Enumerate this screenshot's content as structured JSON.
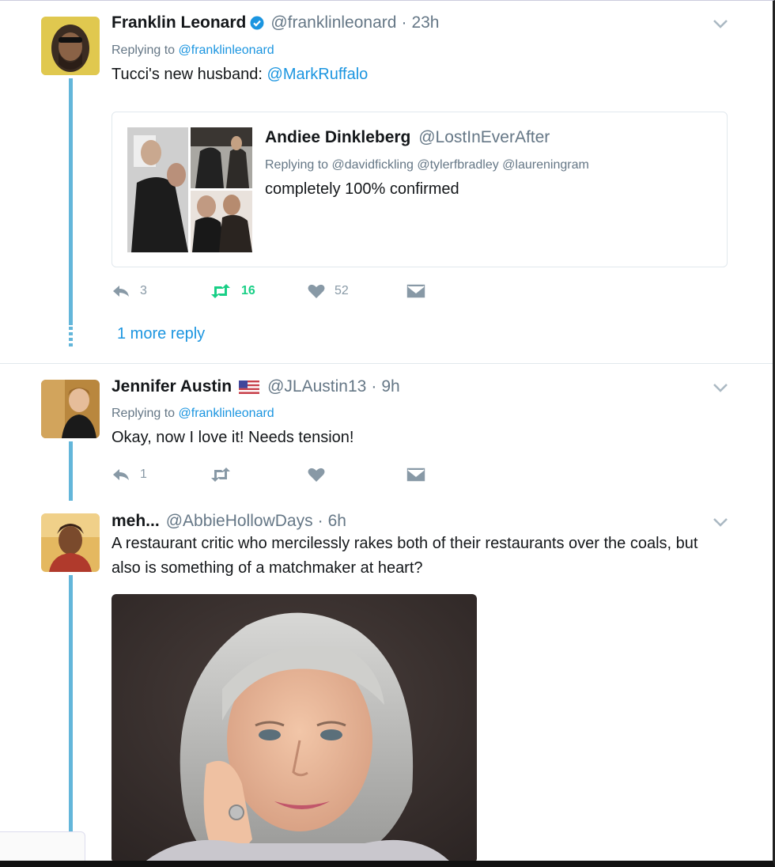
{
  "tweets": [
    {
      "name": "Franklin Leonard",
      "handle": "@franklinleonard",
      "time": "23h",
      "verified": true,
      "replying_prefix": "Replying to",
      "replying_to": "@franklinleonard",
      "text_prefix": "Tucci's new husband:",
      "text_mention": "@MarkRuffalo",
      "quote": {
        "name": "Andiee Dinkleberg",
        "handle": "@LostInEverAfter",
        "replying_prefix": "Replying to",
        "replying_to": "@davidfickling @tylerfbradley @laureningram",
        "text": "completely 100% confirmed"
      },
      "actions": {
        "reply": "3",
        "retweet": "16",
        "like": "52"
      },
      "more_replies": "1 more reply"
    },
    {
      "name": "Jennifer Austin",
      "handle": "@JLAustin13",
      "time": "9h",
      "flag": "us-flag-icon",
      "replying_prefix": "Replying to",
      "replying_to": "@franklinleonard",
      "text": "Okay, now I love it! Needs tension!",
      "actions": {
        "reply": "1"
      }
    },
    {
      "name": "meh...",
      "handle": "@AbbieHollowDays",
      "time": "6h",
      "text": "A restaurant critic who mercilessly rakes both of their restaurants over the coals, but also is something of a matchmaker at heart?"
    }
  ],
  "colors": {
    "accent": "#1b95e0",
    "thread_line": "#63b6da",
    "retweet_active": "#19cf86",
    "muted": "#8899a6"
  },
  "icons": [
    "verified-badge-icon",
    "chevron-down-icon",
    "reply-icon",
    "retweet-icon",
    "heart-icon",
    "dm-icon",
    "us-flag-icon"
  ],
  "separator": "·"
}
